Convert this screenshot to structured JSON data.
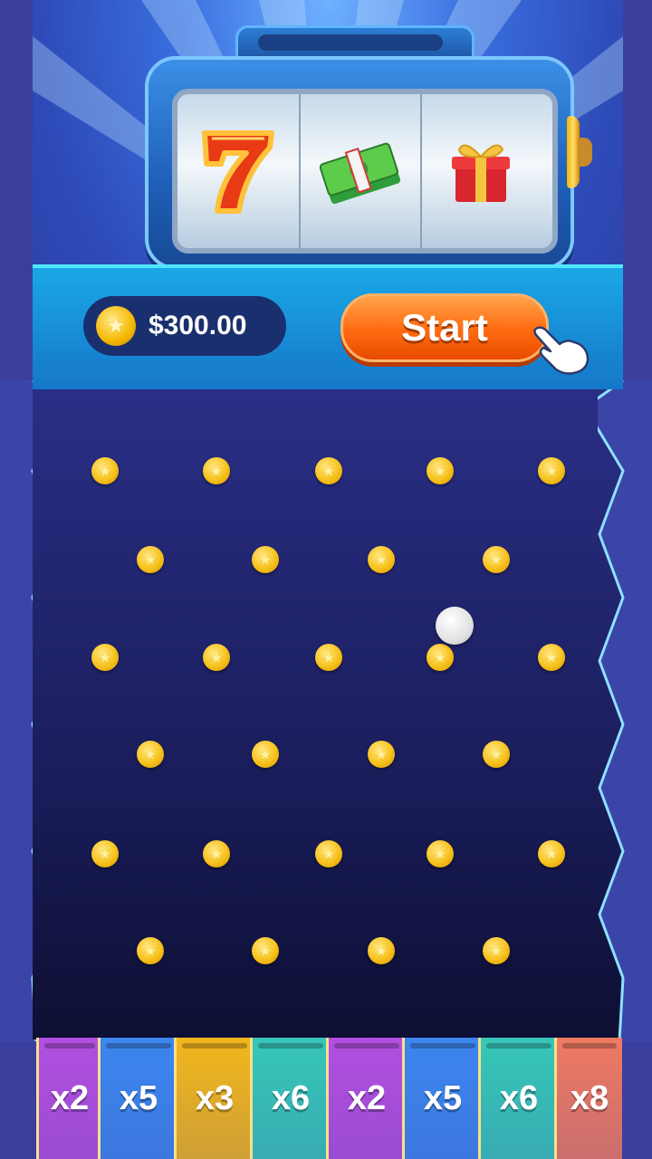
{
  "balance": {
    "amount": "$300.00",
    "icon": "star-coin-icon"
  },
  "start_button": {
    "label": "Start"
  },
  "reels": [
    {
      "symbol": "lucky-seven-icon"
    },
    {
      "symbol": "cash-stack-icon"
    },
    {
      "symbol": "gift-box-icon"
    }
  ],
  "multipliers": [
    {
      "label": "x2",
      "color": "#b24fe0"
    },
    {
      "label": "x5",
      "color": "#3c86ef"
    },
    {
      "label": "x3",
      "color": "#f3b71c"
    },
    {
      "label": "x6",
      "color": "#37c7b8"
    },
    {
      "label": "x2",
      "color": "#b24fe0"
    },
    {
      "label": "x5",
      "color": "#3c86ef"
    },
    {
      "label": "x6",
      "color": "#37c7b8"
    },
    {
      "label": "x8",
      "color": "#ee7a62"
    }
  ],
  "colors": {
    "accent_orange": "#ff6a10",
    "board_dark": "#1a1d5a",
    "peg_gold": "#f7c21c"
  }
}
